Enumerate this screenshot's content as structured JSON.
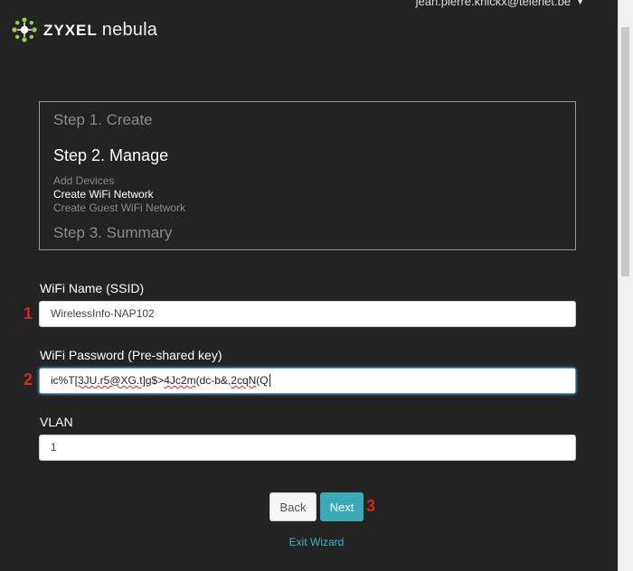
{
  "header": {
    "brand": "ZYXEL",
    "product": "nebula",
    "user_email": "jean.pierre.knickx@telenet.be"
  },
  "steps": {
    "step1": "Step 1. Create",
    "step2": "Step 2. Manage",
    "step2_items": [
      "Add Devices",
      "Create WiFi Network",
      "Create Guest WiFi Network"
    ],
    "step3": "Step 3. Summary"
  },
  "form": {
    "ssid_label": "WiFi Name (SSID)",
    "ssid_value": "WirelessInfo-NAP102",
    "password_label": "WiFi Password (Pre-shared key)",
    "password_parts": [
      "ic%T",
      "[3JU.r5@XG.t]",
      "g$>",
      "4Jc2m",
      "(dc-b&,",
      "2cqN",
      "(Q"
    ],
    "vlan_label": "VLAN",
    "vlan_value": "1"
  },
  "markers": {
    "ssid": "1",
    "password": "2",
    "next": "3"
  },
  "buttons": {
    "back": "Back",
    "next": "Next",
    "exit": "Exit Wizard"
  },
  "colors": {
    "accent": "#3aa9b7",
    "marker": "#d9251c",
    "background": "#232323"
  }
}
